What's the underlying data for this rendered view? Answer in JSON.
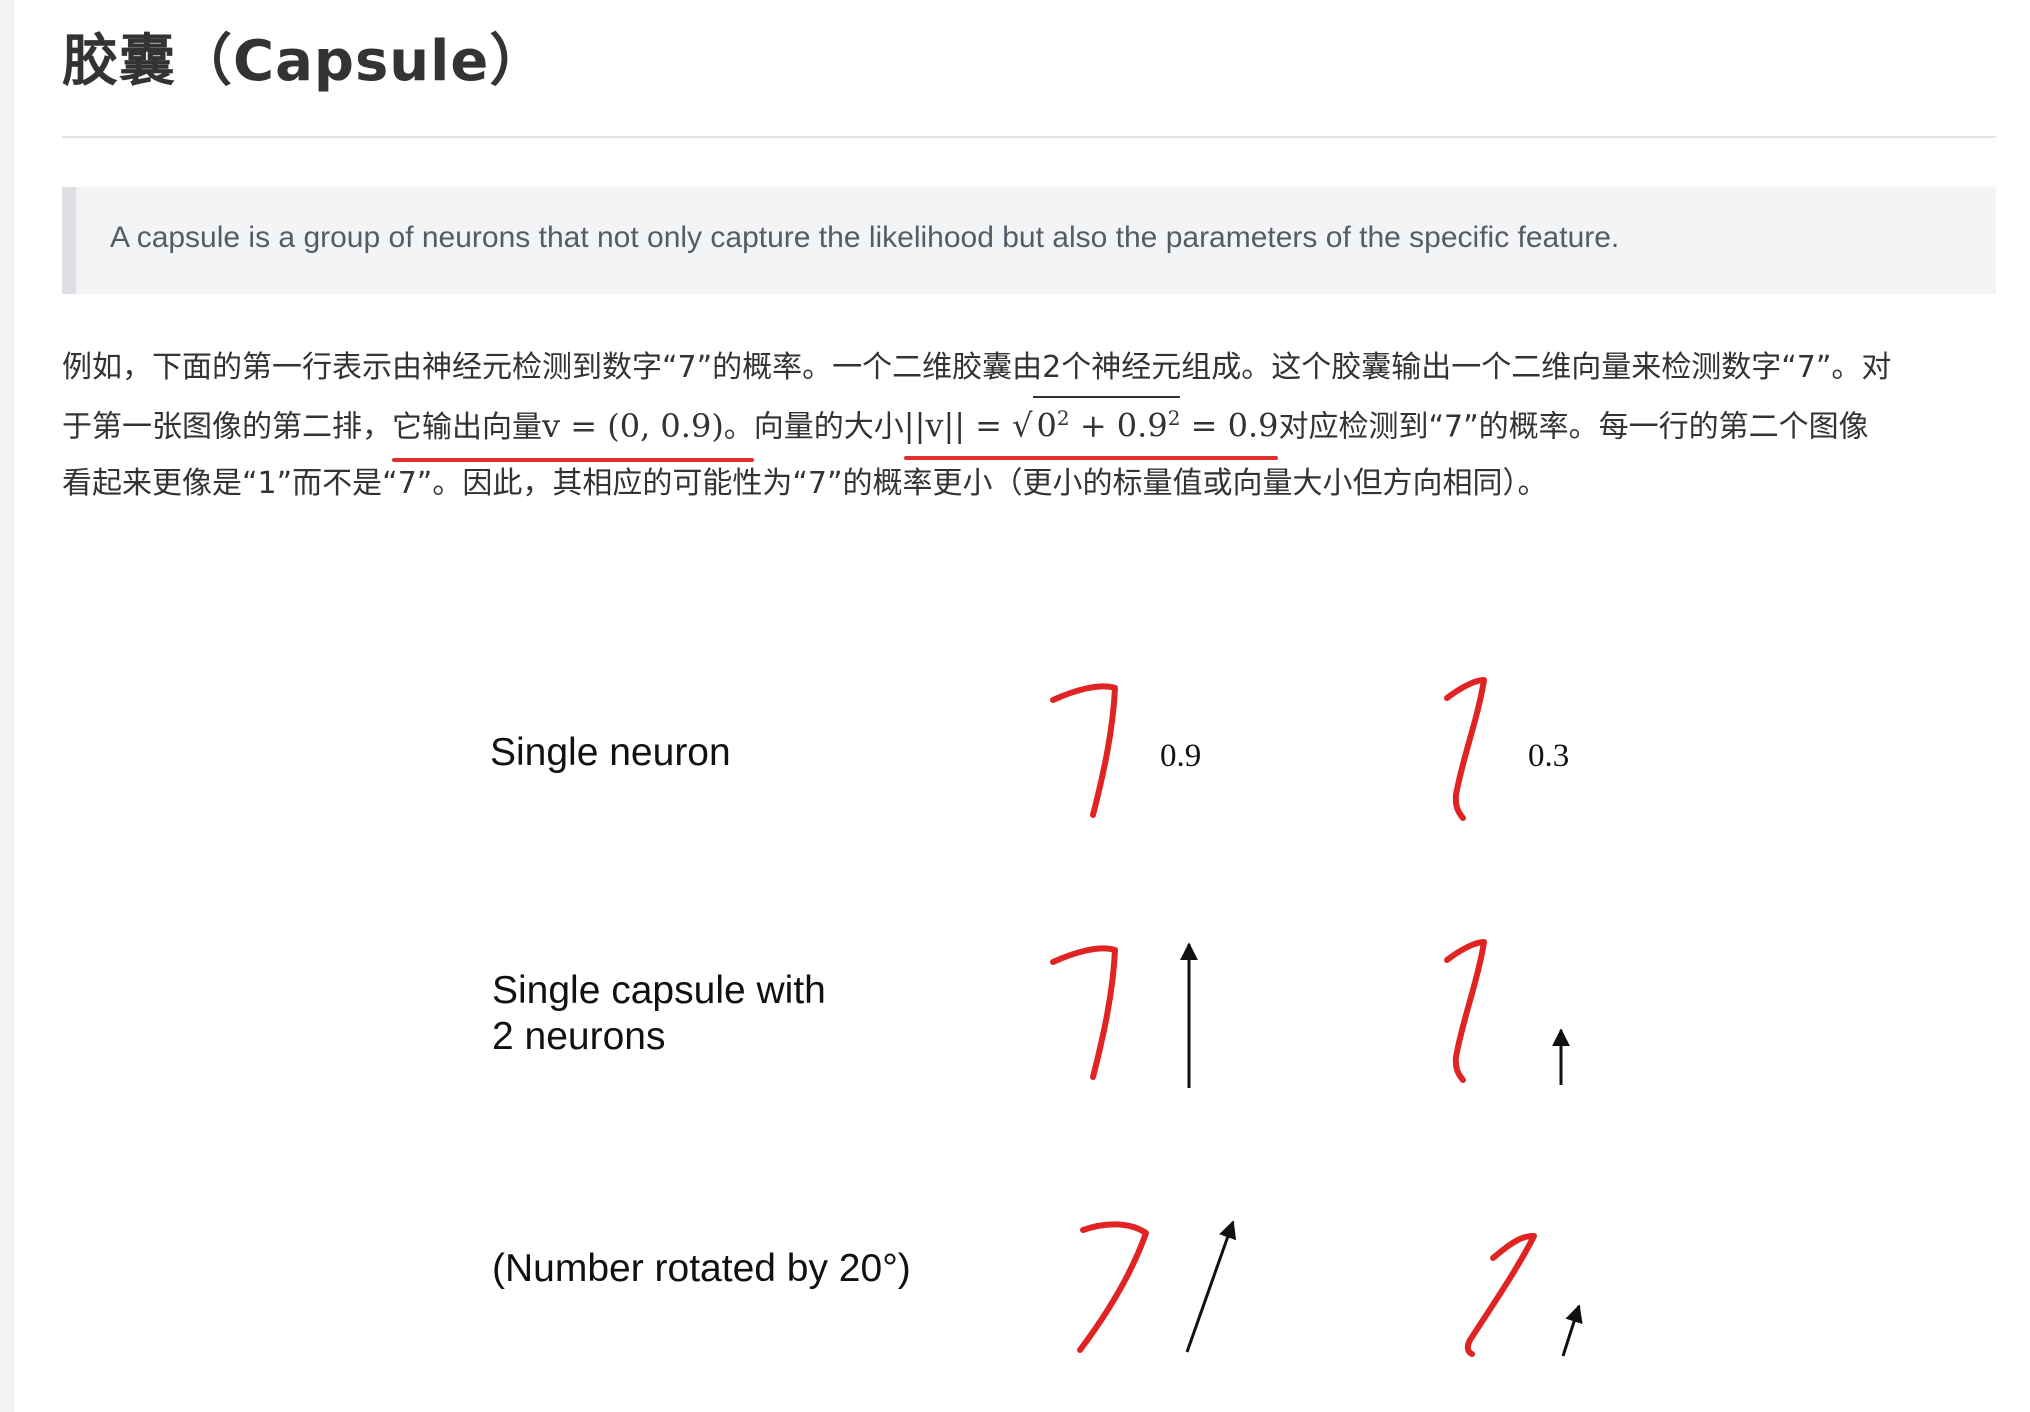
{
  "page": {
    "title": "胶囊（Capsule）",
    "quote": "A capsule is a group of neurons that not only capture the likelihood but also the parameters of the specific feature.",
    "paragraph": {
      "line1": "例如，下面的第一行表示由神经元检测到数字“7”的概率。一个二维胶囊由2个神经元组成。这个胶囊输出一个二维向量来检测数字“7”。对",
      "line2_a": "于第一张图像的第二排，",
      "line2_b": "它输出向量",
      "line2_math1": "v = (0, 0.9)",
      "line2_c": "。",
      "line2_d": "向量的大小",
      "line2_math2a": "||v|| = ",
      "line2_math2b": "0",
      "line2_math2c": "2",
      "line2_math2d": " + 0.9",
      "line2_math2e": "2",
      "line2_math2f": " = 0.9",
      "line2_e": "对应检测到“7”的概率。每一行的第二个图像",
      "line3": "看起来更像是“1”而不是“7”。因此，其相应的可能性为“7”的概率更小（更小的标量值或向量大小但方向相同）。"
    }
  },
  "figure": {
    "row1_label": "Single neuron",
    "row2_label_line1": "Single capsule with",
    "row2_label_line2": "2 neurons",
    "row3_label": "(Number rotated by 20°)",
    "value_seven": "0.9",
    "value_one": "0.3",
    "digit_color": "#e02424"
  }
}
